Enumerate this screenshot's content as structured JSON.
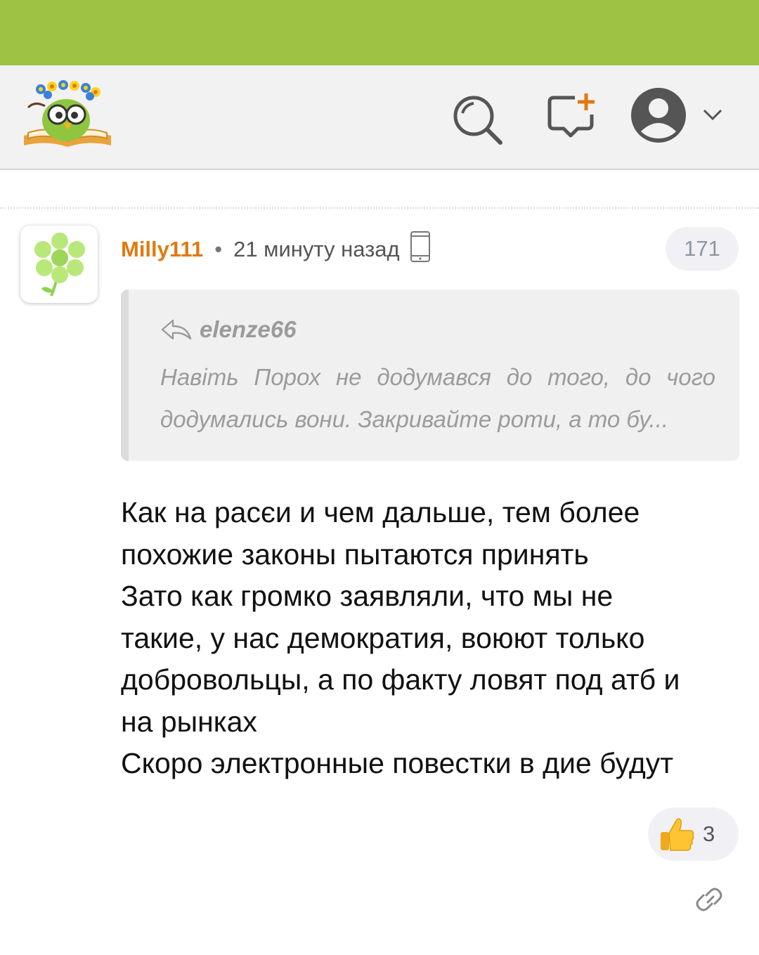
{
  "colors": {
    "status_bar": "#9dc244",
    "header_bg": "#f2f2f2",
    "username": "#e07a10",
    "quote_text": "#9b9b9b",
    "pill_bg": "#f1f1f5"
  },
  "header": {
    "logo_icon": "owl-on-book-logo",
    "search_icon": "search-icon",
    "new_post_icon": "speech-bubble-plus-icon",
    "account_icon": "user-avatar-icon",
    "account_menu_icon": "chevron-down-icon"
  },
  "comment": {
    "avatar_icon": "green-flower-avatar",
    "username": "Milly111",
    "separator": "•",
    "timestamp": "21 минуту назад",
    "device_icon": "mobile-phone-icon",
    "number": "171",
    "reply_to": {
      "icon": "reply-arrow-icon",
      "author": "elenze66",
      "text": "Навіть Порох не додумався до того, до чого додумались вони. Закривайте роти, а то бу..."
    },
    "body_lines": [
      "Как на расєи и чем дальше, тем более",
      "похожие законы пытаются принять",
      "Зато как громко заявляли, что мы не",
      "такие, у нас демократия, воюют только",
      "добровольцы, а по факту ловят под атб и",
      "на рынках",
      "Скоро электронные повестки в дие будут"
    ],
    "likes": {
      "icon": "thumbs-up-icon",
      "count": "3"
    },
    "link_icon": "link-icon"
  }
}
